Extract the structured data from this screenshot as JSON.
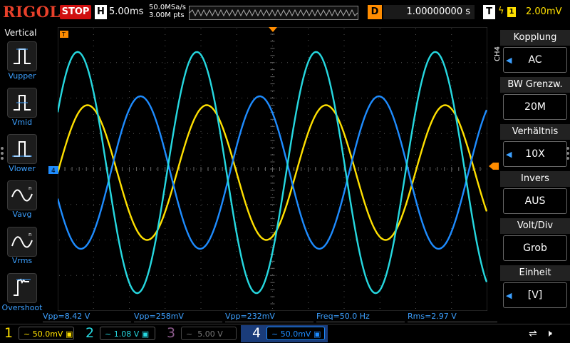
{
  "header": {
    "logo": "RIGOL",
    "run_state": "STOP",
    "h_label": "H",
    "timebase": "5.00ms",
    "sample_rate": "50.0MSa/s",
    "memory_points": "3.00M pts",
    "d_label": "D",
    "delay": "1.00000000 s",
    "t_label": "T",
    "trigger_level": "2.00mV",
    "trigger_channel": "1"
  },
  "measure_panel": {
    "title": "Vertical",
    "items": [
      {
        "label": "Vupper",
        "icon": "vupper-icon"
      },
      {
        "label": "Vmid",
        "icon": "vmid-icon"
      },
      {
        "label": "Vlower",
        "icon": "vlower-icon"
      },
      {
        "label": "Vavg",
        "icon": "vavg-icon"
      },
      {
        "label": "Vrms",
        "icon": "vrms-icon"
      },
      {
        "label": "Overshoot",
        "icon": "overshoot-icon"
      }
    ]
  },
  "right_menu": {
    "channel_label": "CH4",
    "items": [
      {
        "header": "Kopplung",
        "value": "AC",
        "has_arrow": true
      },
      {
        "header": "BW Grenzw.",
        "value": "20M",
        "has_arrow": false
      },
      {
        "header": "Verhältnis",
        "value": "10X",
        "has_arrow": true
      },
      {
        "header": "Invers",
        "value": "AUS",
        "has_arrow": false
      },
      {
        "header": "Volt/Div",
        "value": "Grob",
        "has_arrow": false
      },
      {
        "header": "Einheit",
        "value": "[V]",
        "has_arrow": true
      }
    ]
  },
  "measurements": [
    {
      "text": "Vpp=8.42 V",
      "color": "#3ca0ff"
    },
    {
      "text": "Vpp=258mV",
      "color": "#3ca0ff"
    },
    {
      "text": "Vpp=232mV",
      "color": "#3ca0ff"
    },
    {
      "text": "Freq=50.0 Hz",
      "color": "#3ca0ff"
    },
    {
      "text": "Rms=2.97 V",
      "color": "#3ca0ff"
    }
  ],
  "channels": [
    {
      "num": "1",
      "scale": "50.0mV",
      "color": "#ffe000",
      "active": false,
      "enabled": true
    },
    {
      "num": "2",
      "scale": "1.08 V",
      "color": "#26d8e0",
      "active": false,
      "enabled": true
    },
    {
      "num": "3",
      "scale": "5.00 V",
      "color": "#c080c0",
      "active": false,
      "enabled": false
    },
    {
      "num": "4",
      "scale": "50.0mV",
      "color": "#1e8cff",
      "active": true,
      "enabled": true
    }
  ],
  "waveforms": {
    "ch1": {
      "color": "#ffe000",
      "period_divs": 3.33,
      "amplitude_divs": 1.9,
      "center_divs": 4.1,
      "phase_deg": 0
    },
    "ch2": {
      "color": "#26d8e0",
      "period_divs": 3.33,
      "amplitude_divs": 3.4,
      "center_divs": 4.1,
      "phase_deg": 30
    },
    "ch4": {
      "color": "#1e8cff",
      "period_divs": 3.33,
      "amplitude_divs": 2.15,
      "center_divs": 4.1,
      "phase_deg": 200
    }
  }
}
